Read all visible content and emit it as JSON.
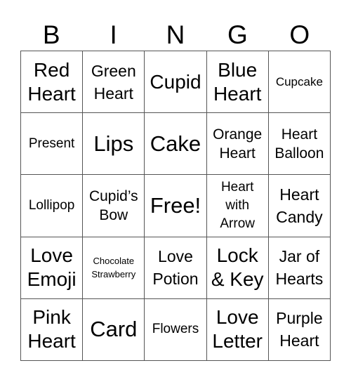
{
  "header": {
    "letters": [
      "B",
      "I",
      "N",
      "G",
      "O"
    ]
  },
  "grid": {
    "rows": [
      [
        {
          "text": "Red\nHeart",
          "size": "s-l"
        },
        {
          "text": "Green\nHeart",
          "size": "s-m"
        },
        {
          "text": "Cupid",
          "size": "s-l"
        },
        {
          "text": "Blue\nHeart",
          "size": "s-l"
        },
        {
          "text": "Cupcake",
          "size": "s-xs"
        }
      ],
      [
        {
          "text": "Present",
          "size": "s-s"
        },
        {
          "text": "Lips",
          "size": "s-xl"
        },
        {
          "text": "Cake",
          "size": "s-xl"
        },
        {
          "text": "Orange\nHeart",
          "size": "s-ms"
        },
        {
          "text": "Heart\nBalloon",
          "size": "s-ms"
        }
      ],
      [
        {
          "text": "Lollipop",
          "size": "s-s"
        },
        {
          "text": "Cupid’s\nBow",
          "size": "s-ms"
        },
        {
          "text": "Free!",
          "size": "s-xl"
        },
        {
          "text": "Heart\nwith\nArrow",
          "size": "s-s"
        },
        {
          "text": "Heart\nCandy",
          "size": "s-m"
        }
      ],
      [
        {
          "text": "Love\nEmoji",
          "size": "s-l"
        },
        {
          "text": "Chocolate\nStrawberry",
          "size": "s-xxs"
        },
        {
          "text": "Love\nPotion",
          "size": "s-m"
        },
        {
          "text": "Lock\n& Key",
          "size": "s-l"
        },
        {
          "text": "Jar of\nHearts",
          "size": "s-m"
        }
      ],
      [
        {
          "text": "Pink\nHeart",
          "size": "s-l"
        },
        {
          "text": "Card",
          "size": "s-xl"
        },
        {
          "text": "Flowers",
          "size": "s-s"
        },
        {
          "text": "Love\nLetter",
          "size": "s-l"
        },
        {
          "text": "Purple\nHeart",
          "size": "s-m"
        }
      ]
    ]
  }
}
